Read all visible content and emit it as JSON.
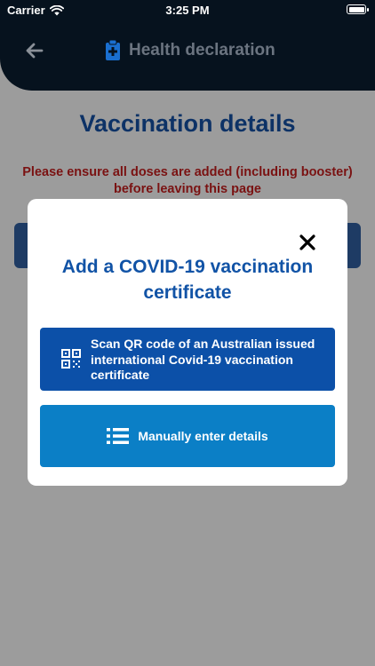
{
  "status_bar": {
    "carrier": "Carrier",
    "time": "3:25 PM"
  },
  "header": {
    "title": "Health declaration"
  },
  "page": {
    "title": "Vaccination details",
    "warning": "Please ensure all doses are added (including booster) before leaving this page"
  },
  "modal": {
    "title": "Add a COVID-19 vaccination certificate",
    "scan_button_label": "Scan QR code of an Australian issued international Covid-19 vaccination certificate",
    "manual_button_label": "Manually enter details"
  },
  "colors": {
    "header_bg": "#06121e",
    "title_blue": "#0d3266",
    "warning_red": "#7a1212",
    "scan_button": "#0c50a8",
    "manual_button": "#0b7fc6"
  },
  "icons": [
    "wifi-icon",
    "battery-icon",
    "back-arrow-icon",
    "clipboard-medical-icon",
    "close-icon",
    "qr-code-icon",
    "list-icon"
  ]
}
